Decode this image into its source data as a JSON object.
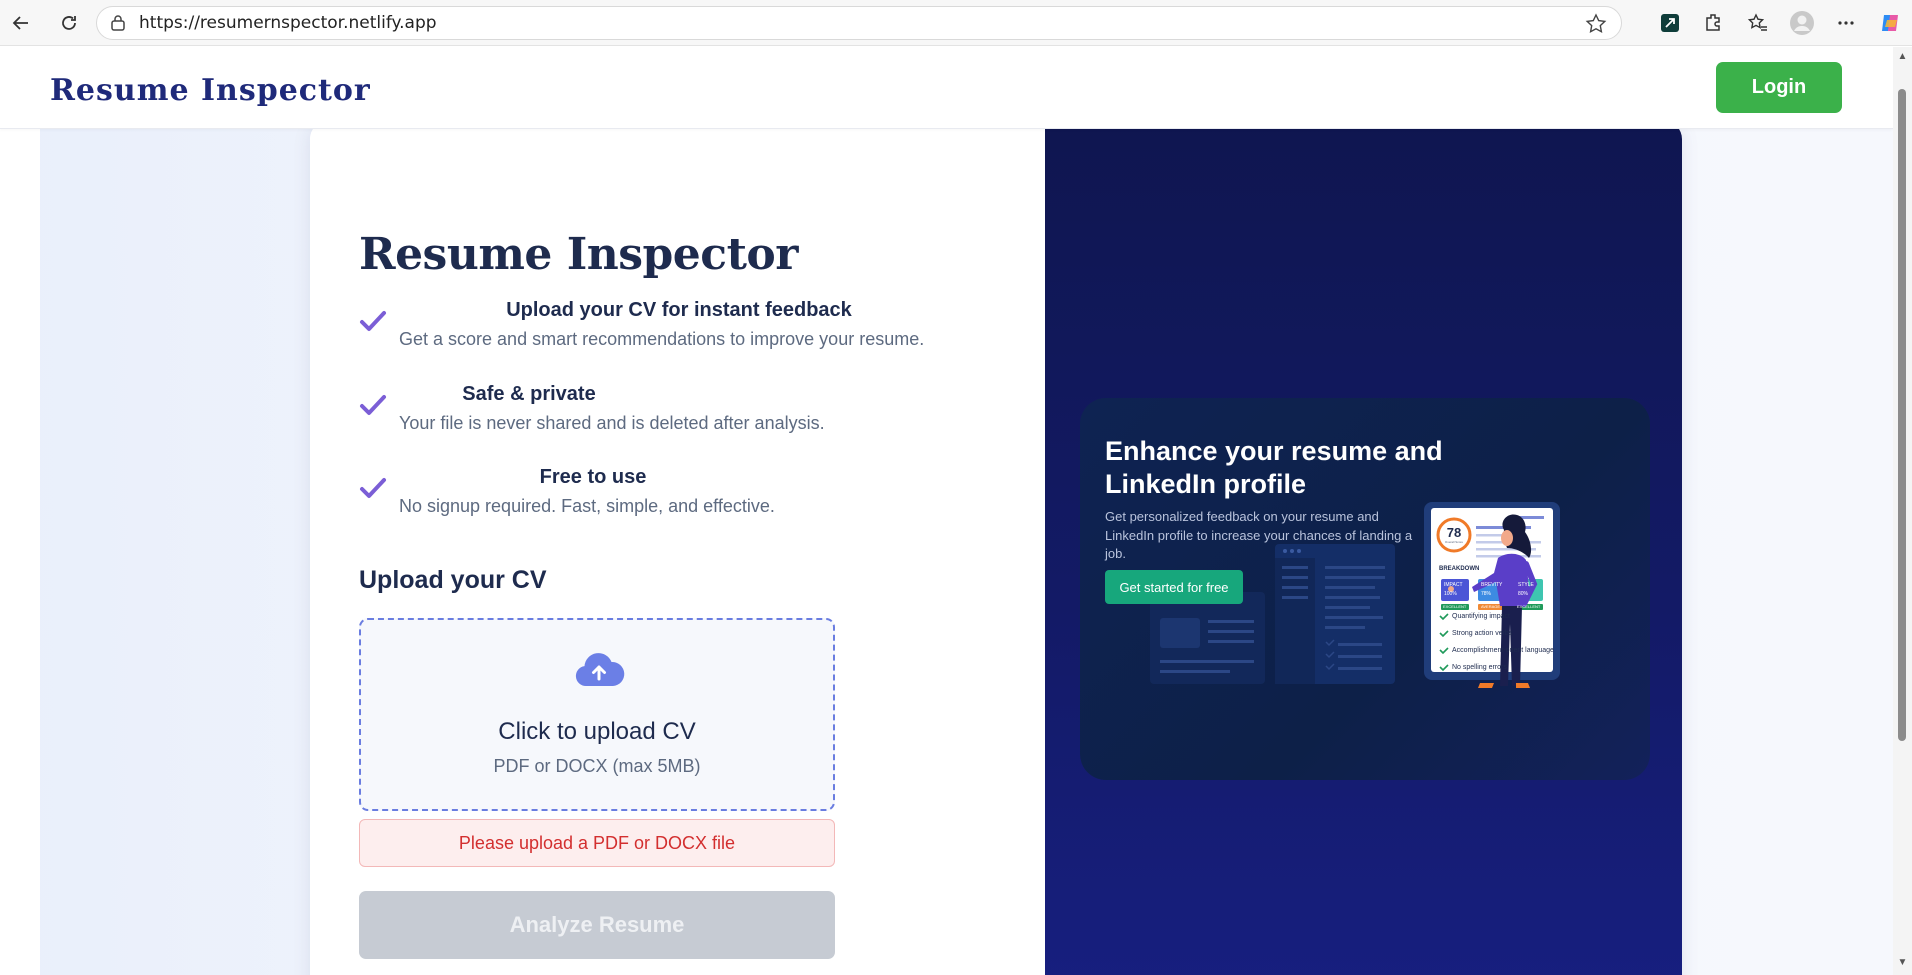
{
  "browser": {
    "url": "https://resumernspector.netlify.app"
  },
  "header": {
    "brand": "Resume Inspector",
    "login_label": "Login"
  },
  "main": {
    "title": "Resume Inspector",
    "features": [
      {
        "title": "Upload your CV for instant feedback",
        "desc": "Get a score and smart recommendations to improve your resume."
      },
      {
        "title": "Safe & private",
        "desc": "Your file is never shared and is deleted after analysis."
      },
      {
        "title": "Free to use",
        "desc": "No signup required. Fast, simple, and effective."
      }
    ],
    "upload_heading": "Upload your CV",
    "dropzone": {
      "title": "Click to upload CV",
      "subtitle": "PDF or DOCX (max 5MB)",
      "icon": "cloud-upload-icon"
    },
    "error": "Please upload a PDF or DOCX file",
    "analyze_label": "Analyze Resume"
  },
  "promo": {
    "heading": "Enhance your resume and LinkedIn profile",
    "description": "Get personalized feedback on your resume and LinkedIn profile to increase your chances of landing a job.",
    "cta_label": "Get started for free",
    "report": {
      "score": "78",
      "score_label": "Overall Score",
      "breakdown_label": "BREAKDOWN",
      "metrics": [
        {
          "name": "IMPACT",
          "value": "100%",
          "rating": "EXCELLENT"
        },
        {
          "name": "BREVITY",
          "value": "78%",
          "rating": "AVERAGE"
        },
        {
          "name": "STYLE",
          "value": "80%",
          "rating": "EXCELLENT"
        }
      ],
      "checks": [
        "Quantifying impact",
        "Strong action verbs",
        "Accomplishment-orient language",
        "No spelling errors"
      ]
    }
  },
  "colors": {
    "brand": "#1f2a7a",
    "login": "#3bb14a",
    "accent": "#6a7de0",
    "check": "#7b5ed6",
    "error": "#d32f2f",
    "cta": "#17a77c"
  }
}
